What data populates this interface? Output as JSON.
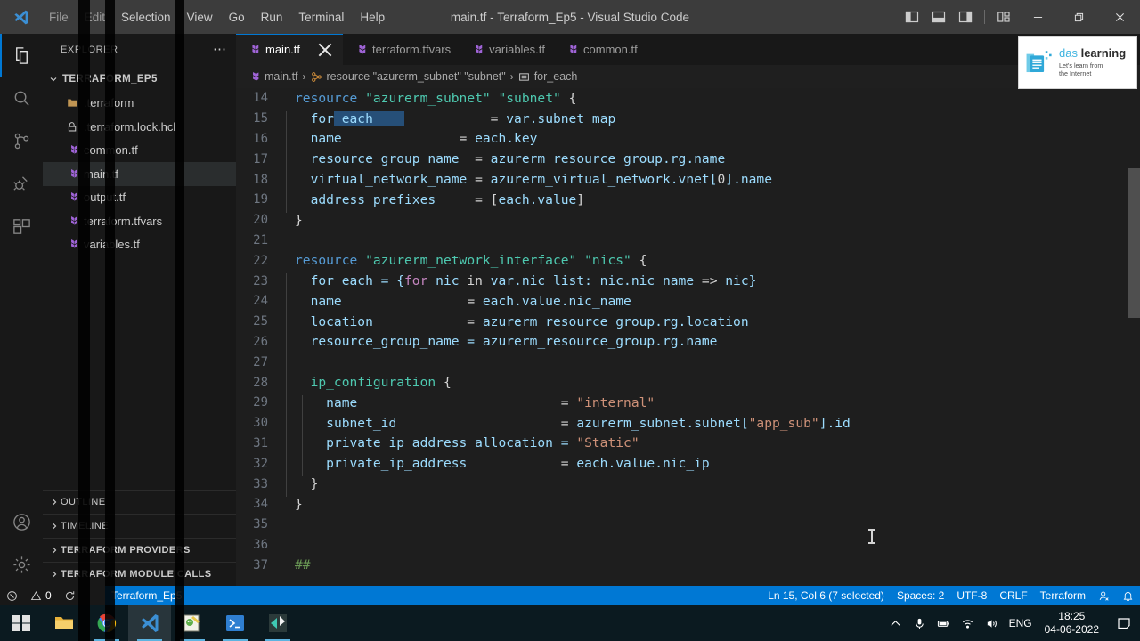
{
  "window": {
    "title": "main.tf - Terraform_Ep5 - Visual Studio Code",
    "menu": [
      "File",
      "Edit",
      "Selection",
      "View",
      "Go",
      "Run",
      "Terminal",
      "Help"
    ],
    "layout_icons": [
      "toggle-primary-sidebar-icon",
      "toggle-panel-icon",
      "toggle-secondary-sidebar-icon",
      "customize-layout-icon"
    ],
    "controls": [
      "minimize",
      "restore",
      "close"
    ]
  },
  "activitybar": {
    "items": [
      {
        "name": "explorer",
        "icon": "files-icon",
        "active": true
      },
      {
        "name": "search",
        "icon": "search-icon",
        "active": false
      },
      {
        "name": "source-control",
        "icon": "source-control-icon",
        "active": false
      },
      {
        "name": "run-and-debug",
        "icon": "debug-icon",
        "active": false
      },
      {
        "name": "extensions",
        "icon": "extensions-icon",
        "active": false
      }
    ],
    "bottom": [
      {
        "name": "accounts",
        "icon": "account-icon"
      },
      {
        "name": "settings",
        "icon": "gear-icon"
      }
    ]
  },
  "sidebar": {
    "title": "EXPLORER",
    "more_actions": "⋯",
    "root": "TERRAFORM_EP5",
    "files": [
      {
        "label": ".terraform",
        "icon": "folder-icon",
        "selected": false
      },
      {
        "label": ".terraform.lock.hcl",
        "icon": "lock-file-icon",
        "selected": false
      },
      {
        "label": "common.tf",
        "icon": "terraform-icon",
        "selected": false
      },
      {
        "label": "main.tf",
        "icon": "terraform-icon",
        "selected": true
      },
      {
        "label": "output.tf",
        "icon": "terraform-icon",
        "selected": false
      },
      {
        "label": "terraform.tfvars",
        "icon": "terraform-icon",
        "selected": false
      },
      {
        "label": "variables.tf",
        "icon": "terraform-icon",
        "selected": false
      }
    ],
    "sections": [
      {
        "label": "OUTLINE",
        "bold": false
      },
      {
        "label": "TIMELINE",
        "bold": false
      },
      {
        "label": "TERRAFORM PROVIDERS",
        "bold": true
      },
      {
        "label": "TERRAFORM MODULE CALLS",
        "bold": true
      }
    ]
  },
  "tabs": [
    {
      "label": "main.tf",
      "active": true,
      "closable": true
    },
    {
      "label": "terraform.tfvars",
      "active": false,
      "closable": false
    },
    {
      "label": "variables.tf",
      "active": false,
      "closable": false
    },
    {
      "label": "common.tf",
      "active": false,
      "closable": false
    }
  ],
  "breadcrumbs": [
    {
      "label": "main.tf",
      "icon": "terraform-icon"
    },
    {
      "label": "resource \"azurerm_subnet\" \"subnet\"",
      "icon": "symbol-namespace-icon"
    },
    {
      "label": "for_each",
      "icon": "symbol-property-icon"
    }
  ],
  "statusbar": {
    "errors": "0",
    "warnings": "0",
    "branch": "Terraform_Ep5",
    "position": "Ln 15, Col 6 (7 selected)",
    "indentation": "Spaces: 2",
    "encoding": "UTF-8",
    "eol": "CRLF",
    "language": "Terraform",
    "accent": "#0078d4"
  },
  "taskbar": {
    "apps": [
      "start-icon",
      "file-explorer-icon",
      "chrome-icon",
      "vscode-icon",
      "notepad-icon",
      "powershell-icon",
      "teal-app-icon"
    ],
    "tray": [
      "show-hidden-icons-chevron",
      "microphone-icon",
      "battery-icon",
      "wifi-icon",
      "volume-icon"
    ],
    "language": "ENG",
    "time": "18:25",
    "date": "04-06-2022",
    "notification": "notification-icon"
  },
  "watermark": {
    "brand_light": "das",
    "brand_bold": "learning",
    "tagline_line1": "Let's learn from",
    "tagline_line2": "the Internet",
    "accent": "#3fb4e0"
  },
  "editor": {
    "language": "terraform",
    "first_line": 14,
    "lines": [
      {
        "n": 14,
        "indent": 0,
        "tokens": [
          {
            "t": "resource",
            "c": "t-kw"
          },
          {
            "t": " ",
            "c": "t-plain"
          },
          {
            "t": "\"azurerm_subnet\"",
            "c": "t-type"
          },
          {
            "t": " ",
            "c": "t-plain"
          },
          {
            "t": "\"subnet\"",
            "c": "t-type"
          },
          {
            "t": " {",
            "c": "t-plain"
          }
        ]
      },
      {
        "n": 15,
        "indent": 1,
        "tokens": [
          {
            "t": "for",
            "c": "t-prop"
          },
          {
            "t": "_each",
            "c": "t-prop sel"
          },
          {
            "t": "    ",
            "c": "sel"
          },
          {
            "t": "           = ",
            "c": "t-plain"
          },
          {
            "t": "var.subnet_map",
            "c": "t-prop"
          }
        ]
      },
      {
        "n": 16,
        "indent": 1,
        "tokens": [
          {
            "t": "name",
            "c": "t-prop"
          },
          {
            "t": "               = ",
            "c": "t-plain"
          },
          {
            "t": "each.key",
            "c": "t-prop"
          }
        ]
      },
      {
        "n": 17,
        "indent": 1,
        "tokens": [
          {
            "t": "resource_group_name",
            "c": "t-prop"
          },
          {
            "t": "  = ",
            "c": "t-plain"
          },
          {
            "t": "azurerm_resource_group.rg.name",
            "c": "t-prop"
          }
        ]
      },
      {
        "n": 18,
        "indent": 1,
        "tokens": [
          {
            "t": "virtual_network_name",
            "c": "t-prop"
          },
          {
            "t": " = ",
            "c": "t-plain"
          },
          {
            "t": "azurerm_virtual_network.vnet[",
            "c": "t-prop"
          },
          {
            "t": "0",
            "c": "t-plain"
          },
          {
            "t": "].name",
            "c": "t-prop"
          }
        ]
      },
      {
        "n": 19,
        "indent": 1,
        "tokens": [
          {
            "t": "address_prefixes",
            "c": "t-prop"
          },
          {
            "t": "     = [",
            "c": "t-plain"
          },
          {
            "t": "each.value",
            "c": "t-prop"
          },
          {
            "t": "]",
            "c": "t-plain"
          }
        ]
      },
      {
        "n": 20,
        "indent": 0,
        "tokens": [
          {
            "t": "}",
            "c": "t-plain"
          }
        ]
      },
      {
        "n": 21,
        "indent": 0,
        "tokens": []
      },
      {
        "n": 22,
        "indent": 0,
        "tokens": [
          {
            "t": "resource",
            "c": "t-kw"
          },
          {
            "t": " ",
            "c": "t-plain"
          },
          {
            "t": "\"azurerm_network_interface\"",
            "c": "t-type"
          },
          {
            "t": " ",
            "c": "t-plain"
          },
          {
            "t": "\"nics\"",
            "c": "t-type"
          },
          {
            "t": " {",
            "c": "t-plain"
          }
        ]
      },
      {
        "n": 23,
        "indent": 1,
        "tokens": [
          {
            "t": "for_each = {",
            "c": "t-prop"
          },
          {
            "t": "for",
            "c": "t-for"
          },
          {
            "t": " nic ",
            "c": "t-prop"
          },
          {
            "t": "in",
            "c": "t-plain"
          },
          {
            "t": " var.nic_list: nic.nic_name ",
            "c": "t-prop"
          },
          {
            "t": "=>",
            "c": "t-plain"
          },
          {
            "t": " nic}",
            "c": "t-prop"
          }
        ]
      },
      {
        "n": 24,
        "indent": 1,
        "tokens": [
          {
            "t": "name",
            "c": "t-prop"
          },
          {
            "t": "                = ",
            "c": "t-plain"
          },
          {
            "t": "each.value.nic_name",
            "c": "t-prop"
          }
        ]
      },
      {
        "n": 25,
        "indent": 1,
        "tokens": [
          {
            "t": "location",
            "c": "t-prop"
          },
          {
            "t": "            = ",
            "c": "t-plain"
          },
          {
            "t": "azurerm_resource_group.rg.location",
            "c": "t-prop"
          }
        ]
      },
      {
        "n": 26,
        "indent": 1,
        "tokens": [
          {
            "t": "resource_group_name = ",
            "c": "t-prop"
          },
          {
            "t": "azurerm_resource_group.rg.name",
            "c": "t-prop"
          }
        ]
      },
      {
        "n": 27,
        "indent": 1,
        "tokens": []
      },
      {
        "n": 28,
        "indent": 1,
        "tokens": [
          {
            "t": "ip_configuration",
            "c": "t-block"
          },
          {
            "t": " {",
            "c": "t-plain"
          }
        ]
      },
      {
        "n": 29,
        "indent": 2,
        "tokens": [
          {
            "t": "name",
            "c": "t-prop"
          },
          {
            "t": "                          = ",
            "c": "t-plain"
          },
          {
            "t": "\"internal\"",
            "c": "t-str"
          }
        ]
      },
      {
        "n": 30,
        "indent": 2,
        "tokens": [
          {
            "t": "subnet_id",
            "c": "t-prop"
          },
          {
            "t": "                     = ",
            "c": "t-plain"
          },
          {
            "t": "azurerm_subnet.subnet[",
            "c": "t-prop"
          },
          {
            "t": "\"app_sub\"",
            "c": "t-str"
          },
          {
            "t": "].id",
            "c": "t-prop"
          }
        ]
      },
      {
        "n": 31,
        "indent": 2,
        "tokens": [
          {
            "t": "private_ip_address_allocation = ",
            "c": "t-prop"
          },
          {
            "t": "\"Static\"",
            "c": "t-str"
          }
        ]
      },
      {
        "n": 32,
        "indent": 2,
        "tokens": [
          {
            "t": "private_ip_address",
            "c": "t-prop"
          },
          {
            "t": "            = ",
            "c": "t-plain"
          },
          {
            "t": "each.value.nic_ip",
            "c": "t-prop"
          }
        ]
      },
      {
        "n": 33,
        "indent": 1,
        "tokens": [
          {
            "t": "}",
            "c": "t-plain"
          }
        ]
      },
      {
        "n": 34,
        "indent": 0,
        "tokens": [
          {
            "t": "}",
            "c": "t-plain"
          }
        ]
      },
      {
        "n": 35,
        "indent": 0,
        "tokens": []
      },
      {
        "n": 36,
        "indent": 0,
        "tokens": []
      },
      {
        "n": 37,
        "indent": 0,
        "tokens": [
          {
            "t": "##",
            "c": "t-comment"
          }
        ]
      }
    ]
  }
}
